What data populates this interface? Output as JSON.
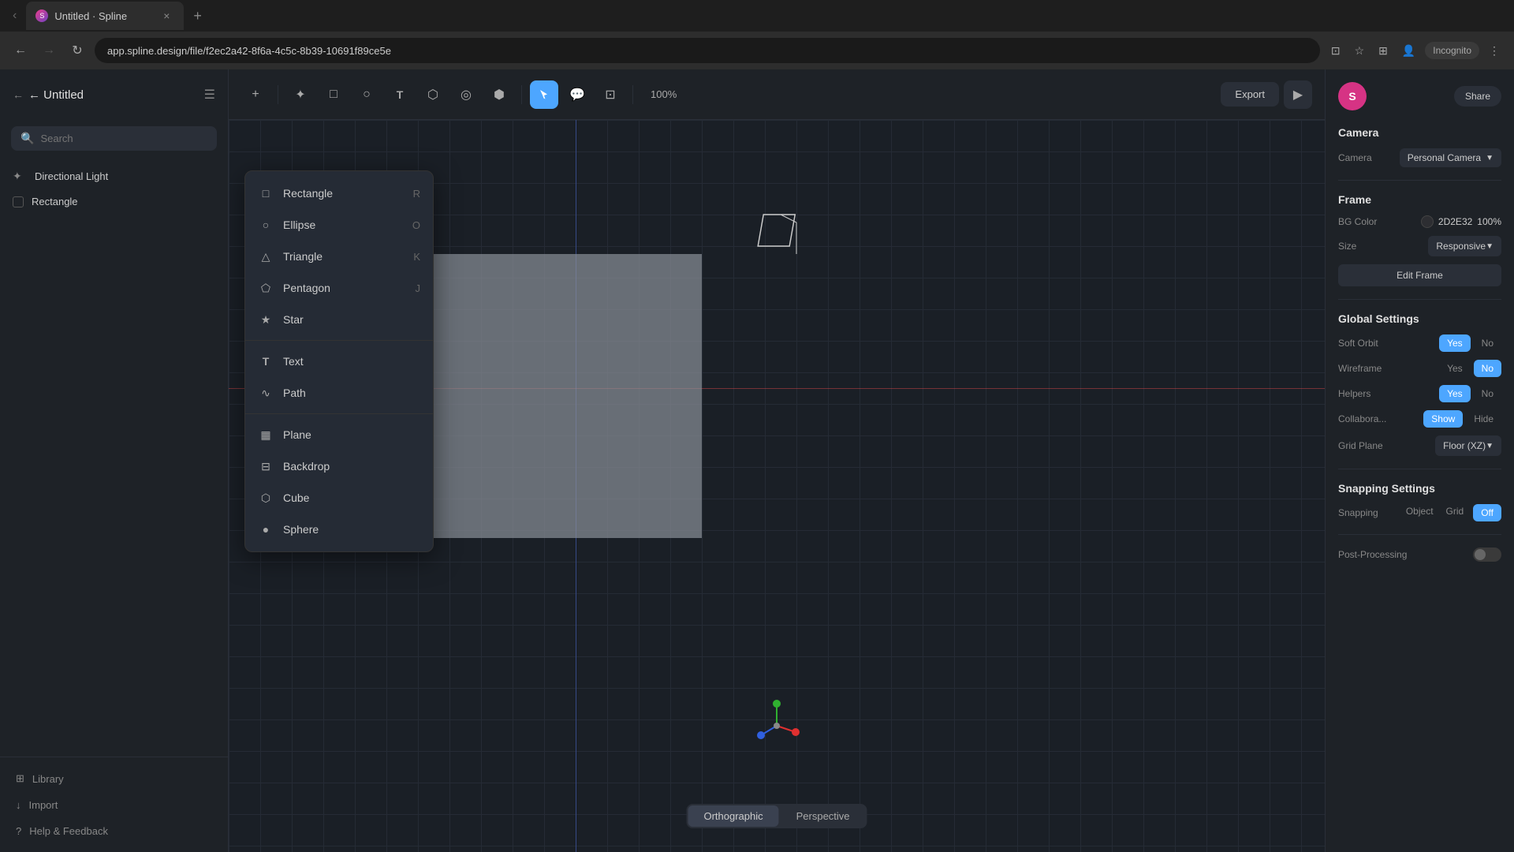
{
  "browser": {
    "tab_title": "Untitled · Spline",
    "tab_close": "×",
    "tab_new": "+",
    "url": "app.spline.design/file/f2ec2a42-8f6a-4c5c-8b39-10691f89ce5e",
    "incognito": "Incognito"
  },
  "sidebar": {
    "back_label": "← Untitled",
    "menu_icon": "☰",
    "search_placeholder": "Search",
    "items": [
      {
        "type": "light",
        "label": "Directional Light"
      },
      {
        "type": "rect",
        "label": "Rectangle"
      }
    ],
    "footer": [
      {
        "icon": "⊞",
        "label": "Library"
      },
      {
        "icon": "↓",
        "label": "Import"
      },
      {
        "icon": "?",
        "label": "Help & Feedback"
      }
    ]
  },
  "toolbar": {
    "zoom": "100%",
    "export_label": "Export",
    "tools": [
      "+",
      "✦",
      "□",
      "○",
      "T",
      "◇",
      "◎",
      "⬡",
      "▶",
      "💬",
      "⊡"
    ]
  },
  "dropdown_menu": {
    "items": [
      {
        "icon": "□",
        "label": "Rectangle",
        "shortcut": "R"
      },
      {
        "icon": "○",
        "label": "Ellipse",
        "shortcut": "O"
      },
      {
        "icon": "△",
        "label": "Triangle",
        "shortcut": "K"
      },
      {
        "icon": "⬠",
        "label": "Pentagon",
        "shortcut": "J"
      },
      {
        "icon": "★",
        "label": "Star",
        "shortcut": ""
      }
    ],
    "items2": [
      {
        "icon": "T",
        "label": "Text",
        "shortcut": ""
      },
      {
        "icon": "∿",
        "label": "Path",
        "shortcut": ""
      }
    ],
    "items3": [
      {
        "icon": "▦",
        "label": "Plane",
        "shortcut": ""
      },
      {
        "icon": "⊟",
        "label": "Backdrop",
        "shortcut": ""
      },
      {
        "icon": "⬡",
        "label": "Cube",
        "shortcut": ""
      },
      {
        "icon": "●",
        "label": "Sphere",
        "shortcut": ""
      }
    ]
  },
  "view_controls": {
    "orthographic": "Orthographic",
    "perspective": "Perspective"
  },
  "right_panel": {
    "user_initial": "S",
    "share_label": "Share",
    "camera_section": "Camera",
    "camera_label": "Camera",
    "camera_value": "Personal Camera",
    "frame_section": "Frame",
    "bg_color_label": "BG Color",
    "bg_color_hex": "2D2E32",
    "bg_color_opacity": "100%",
    "size_label": "Size",
    "size_value": "Responsive",
    "edit_frame_label": "Edit Frame",
    "global_settings_section": "Global Settings",
    "soft_orbit_label": "Soft Orbit",
    "soft_orbit_yes": "Yes",
    "soft_orbit_no": "No",
    "wireframe_label": "Wireframe",
    "wireframe_yes": "Yes",
    "wireframe_no": "No",
    "helpers_label": "Helpers",
    "helpers_yes": "Yes",
    "helpers_no": "No",
    "collabora_label": "Collabora...",
    "collabora_show": "Show",
    "collabora_hide": "Hide",
    "grid_plane_label": "Grid Plane",
    "grid_plane_value": "Floor (XZ)",
    "snapping_section": "Snapping Settings",
    "snapping_label": "Snapping",
    "snapping_object": "Object",
    "snapping_grid": "Grid",
    "snapping_off": "Off",
    "post_processing_label": "Post-Processing"
  }
}
